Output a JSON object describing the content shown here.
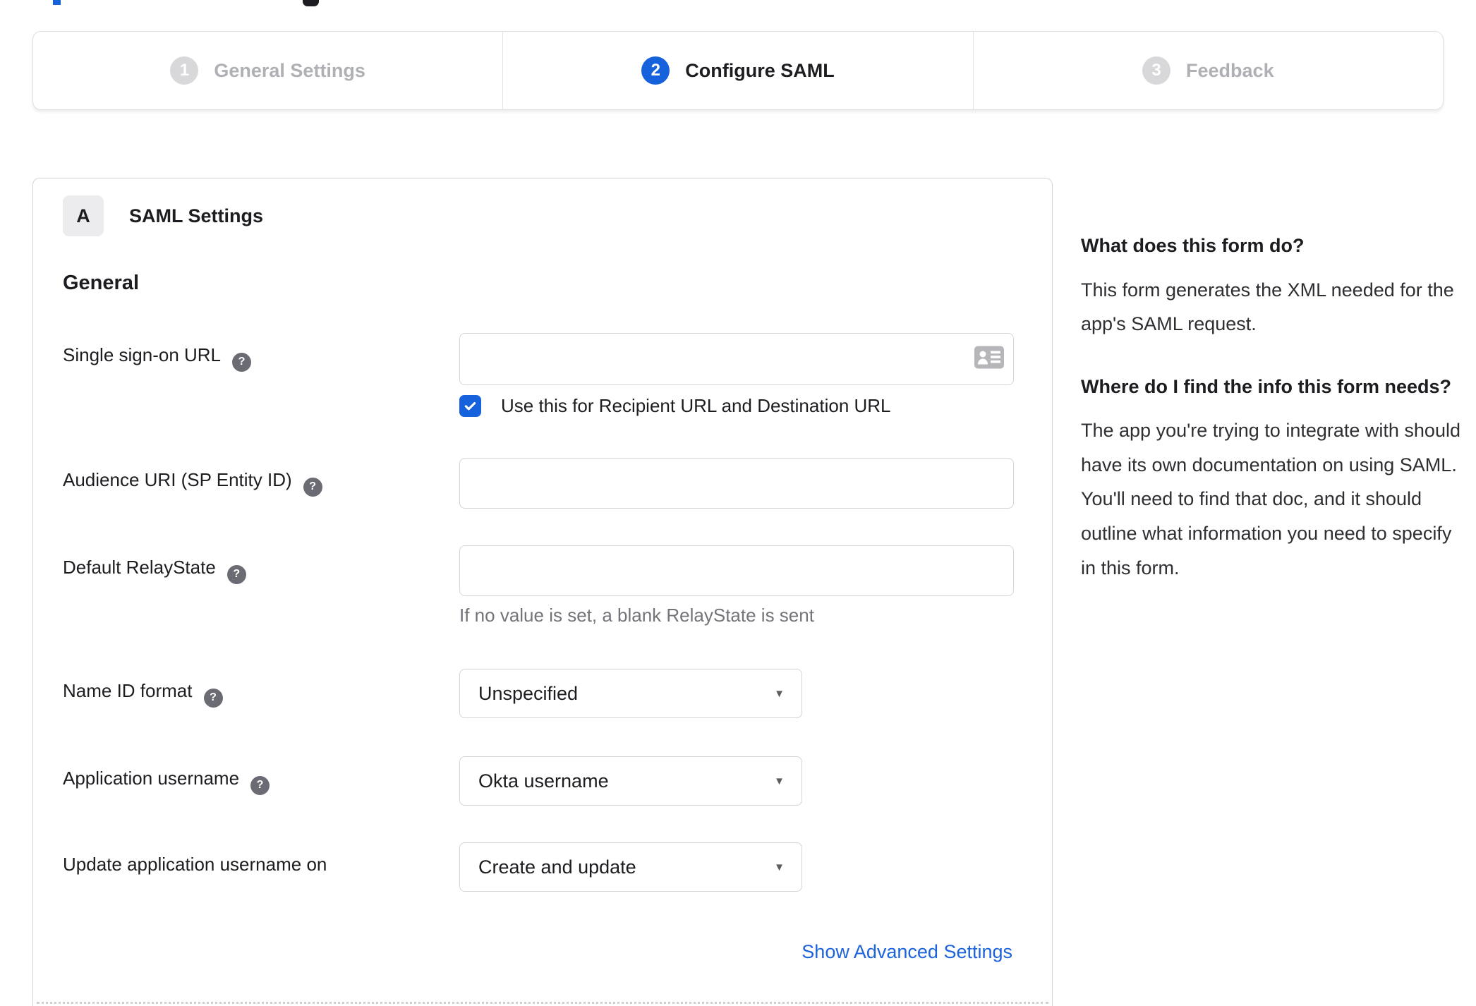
{
  "glyphs": {
    "help": "?",
    "caret": "▼"
  },
  "colors": {
    "accent": "#1662dd",
    "inactive_gray": "#d8d8db",
    "link_blue": "#1d63dc"
  },
  "stepper": {
    "steps": [
      {
        "number": "1",
        "label": "General Settings",
        "state": "inactive"
      },
      {
        "number": "2",
        "label": "Configure SAML",
        "state": "active"
      },
      {
        "number": "3",
        "label": "Feedback",
        "state": "inactive"
      }
    ]
  },
  "panel": {
    "section_badge": "A",
    "section_title": "SAML Settings",
    "group_title": "General",
    "advanced_link": "Show Advanced Settings"
  },
  "fields": {
    "sso": {
      "label": "Single sign-on URL",
      "value": "",
      "checkbox_label": "Use this for Recipient URL and Destination URL",
      "checked": true
    },
    "audience": {
      "label": "Audience URI (SP Entity ID)",
      "value": ""
    },
    "relay": {
      "label": "Default RelayState",
      "value": "",
      "helper": "If no value is set, a blank RelayState is sent"
    },
    "nameid": {
      "label": "Name ID format",
      "value": "Unspecified"
    },
    "appuser": {
      "label": "Application username",
      "value": "Okta username"
    },
    "updateuser": {
      "label": "Update application username on",
      "value": "Create and update"
    }
  },
  "sidebar": {
    "q1": "What does this form do?",
    "a1": "This form generates the XML needed for the app's SAML request.",
    "q2": "Where do I find the info this form needs?",
    "a2": "The app you're trying to integrate with should have its own documentation on using SAML. You'll need to find that doc, and it should outline what information you need to specify in this form."
  }
}
